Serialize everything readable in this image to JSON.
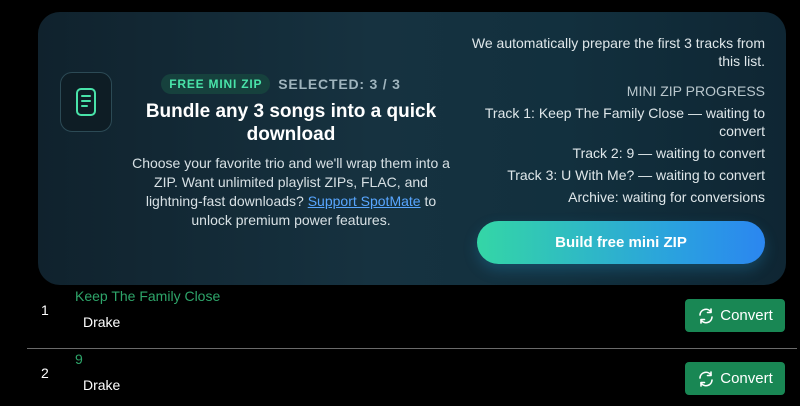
{
  "promo": {
    "badge": "FREE MINI ZIP",
    "selected": "SELECTED: 3 / 3",
    "headline": "Bundle any 3 songs into a quick download",
    "desc_before": "Choose your favorite trio and we'll wrap them into a ZIP. Want unlimited playlist ZIPs, FLAC, and lightning-fast downloads? ",
    "desc_link": "Support SpotMate",
    "desc_after": " to unlock premium power features.",
    "intro": "We automatically prepare the first 3 tracks from this list.",
    "progress_title": "MINI ZIP PROGRESS",
    "progress_lines": [
      "Track 1: Keep The Family Close — waiting to convert",
      "Track 2: 9 — waiting to convert",
      "Track 3: U With Me? — waiting to convert",
      "Archive: waiting for conversions"
    ],
    "build_label": "Build free mini ZIP",
    "accent": "#49e3a9"
  },
  "tracks": [
    {
      "num": "1",
      "title": "Keep The Family Close",
      "artist": "Drake",
      "convert_label": "Convert"
    },
    {
      "num": "2",
      "title": "9",
      "artist": "Drake",
      "convert_label": "Convert"
    }
  ],
  "colors": {
    "convert_bg": "#198754",
    "title_green": "#2ea56a"
  }
}
